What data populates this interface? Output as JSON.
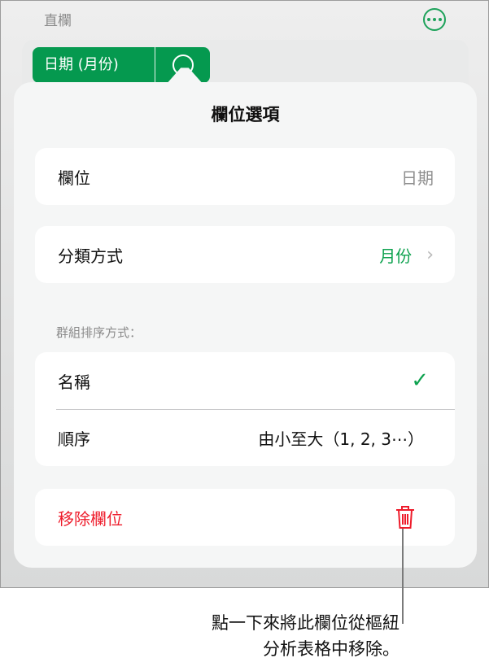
{
  "header": {
    "title": "直欄",
    "more_icon": "ellipsis-circle-icon"
  },
  "field_pill": {
    "label": "日期 (月份)",
    "info_icon": "info-icon"
  },
  "popover": {
    "title": "欄位選項",
    "field": {
      "label": "欄位",
      "value": "日期"
    },
    "group_by": {
      "label": "分類方式",
      "value": "月份"
    },
    "sort_section_label": "群組排序方式：",
    "sort": [
      {
        "label": "名稱",
        "checked": true
      },
      {
        "label": "順序",
        "value": "由小至大（1, 2, 3⋯）"
      }
    ],
    "remove": {
      "label": "移除欄位",
      "icon": "trash-icon"
    }
  },
  "callout": {
    "line1": "點一下來將此欄位從樞紐",
    "line2": "分析表格中移除。"
  },
  "colors": {
    "accent": "#05994f",
    "destructive": "#ee1c2b"
  }
}
